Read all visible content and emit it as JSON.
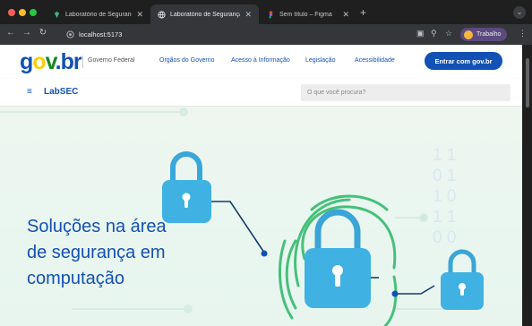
{
  "browser": {
    "tabs": [
      {
        "label": "Laboratório de Segurança em",
        "active": false
      },
      {
        "label": "Laboratório de Segurança em",
        "active": true
      },
      {
        "label": "Sem título – Figma",
        "active": false
      }
    ],
    "new_tab": "+",
    "url": "localhost:5173",
    "profile": "Trabalho",
    "colors": {
      "close": "#ff5f57",
      "minimize": "#febc2e",
      "maximize": "#28c840"
    }
  },
  "gov": {
    "logo": {
      "g": "g",
      "o": "o",
      "v": "v",
      "dot": ".",
      "br": "br"
    },
    "federal": "Governo Federal",
    "links": [
      "Orgãos do Governo",
      "Acesso à Informação",
      "Legislação",
      "Acessibilidade"
    ],
    "login": "Entrar com gov.br"
  },
  "lab": {
    "menu_icon": "≡",
    "title": "LabSEC",
    "search_placeholder": "O que você procura?"
  },
  "hero": {
    "line1": "Soluções na área",
    "line2": "de segurança em",
    "line3": "computação"
  },
  "binary_digits": [
    "1 1",
    "0 1",
    "1 0",
    "1 1",
    "0 0"
  ],
  "accent": "#1351b4"
}
